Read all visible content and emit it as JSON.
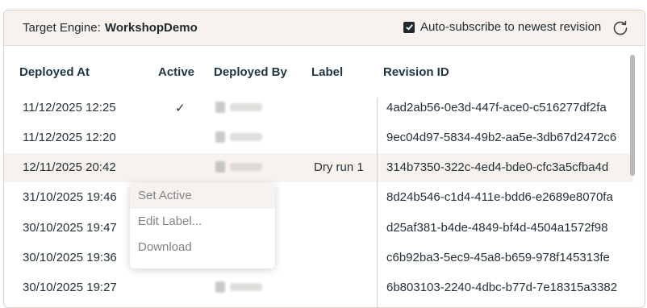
{
  "header": {
    "engine_label": "Target Engine:",
    "engine_name": "WorkshopDemo",
    "auto_subscribe_label": "Auto-subscribe to newest revision",
    "auto_subscribe_checked": true
  },
  "table": {
    "columns": {
      "deployed_at": "Deployed At",
      "active": "Active",
      "deployed_by": "Deployed By",
      "label": "Label",
      "revision_id": "Revision ID"
    },
    "rows": [
      {
        "deployed_at": "11/12/2025 12:25",
        "active": "✓",
        "label": "",
        "revision_id": "4ad2ab56-0e3d-447f-ace0-c516277df2fa"
      },
      {
        "deployed_at": "11/12/2025 12:20",
        "active": "",
        "label": "",
        "revision_id": "9ec04d97-5834-49b2-aa5e-3db67d2472c6"
      },
      {
        "deployed_at": "12/11/2025 20:42",
        "active": "",
        "label": "Dry run 1",
        "revision_id": "314b7350-322c-4ed4-bde0-cfc3a5cfba4d"
      },
      {
        "deployed_at": "31/10/2025 19:46",
        "active": "",
        "label": "",
        "revision_id": "8d24b546-c1d4-411e-bdd6-e2689e8070fa"
      },
      {
        "deployed_at": "30/10/2025 19:47",
        "active": "",
        "label": "",
        "revision_id": "d25af381-b4de-4849-bf4d-4504a1572f98"
      },
      {
        "deployed_at": "30/10/2025 19:36",
        "active": "",
        "label": "",
        "revision_id": "c6b92ba3-5ec9-45a8-b659-978f145313fe"
      },
      {
        "deployed_at": "30/10/2025 19:27",
        "active": "",
        "label": "",
        "revision_id": "6b803103-2240-4dbc-b77d-7e18315a3382"
      }
    ]
  },
  "context_menu": {
    "set_active": "Set Active",
    "edit_label": "Edit Label...",
    "download": "Download"
  },
  "icons": {
    "refresh": "refresh-icon",
    "checkbox": "checkmark-icon",
    "user": "user-avatar-icon"
  }
}
